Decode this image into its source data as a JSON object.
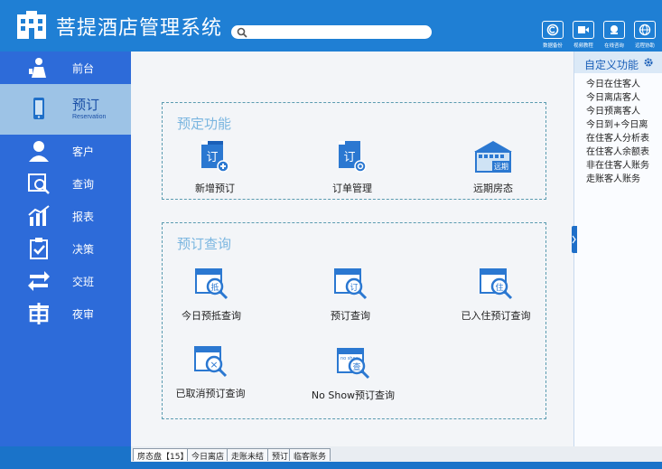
{
  "header": {
    "title": "菩提酒店管理系统",
    "search_placeholder": "",
    "tools": [
      {
        "label": "数据备份",
        "icon": "backup-icon"
      },
      {
        "label": "视频教程",
        "icon": "video-icon"
      },
      {
        "label": "在线咨询",
        "icon": "chat-icon"
      },
      {
        "label": "远程协助",
        "icon": "remote-icon"
      }
    ]
  },
  "sidebar": {
    "items": [
      {
        "label": "前台"
      },
      {
        "label": "预订",
        "sub": "Reservation"
      },
      {
        "label": "客户"
      },
      {
        "label": "查询"
      },
      {
        "label": "报表"
      },
      {
        "label": "决策"
      },
      {
        "label": "交班"
      },
      {
        "label": "夜审"
      }
    ]
  },
  "booking_panel": {
    "title": "预定功能",
    "items": [
      {
        "label": "新增预订",
        "glyph": "订"
      },
      {
        "label": "订单管理",
        "glyph": "订"
      },
      {
        "label": "远期房态",
        "glyph": "远期"
      }
    ]
  },
  "query_panel": {
    "title": "预订查询",
    "items": [
      {
        "label": "今日预抵查询",
        "glyph": "抵"
      },
      {
        "label": "预订查询",
        "glyph": "订"
      },
      {
        "label": "已入住预订查询",
        "glyph": "住"
      },
      {
        "label": "已取消预订查询",
        "glyph": "×"
      },
      {
        "label": "No Show预订查询",
        "glyph": "查",
        "mini": "no show"
      }
    ]
  },
  "right_panel": {
    "title": "自定义功能",
    "items": [
      "今日在住客人",
      "今日离店客人",
      "今日预离客人",
      "今日到+今日离",
      "在住客人分析表",
      "在住客人余额表",
      "非在住客人账务",
      "走账客人账务"
    ]
  },
  "bottom_tabs": [
    "房态盘【15】",
    "今日离店",
    "走账未结",
    "预订",
    "临客账务"
  ],
  "colors": {
    "header": "#1f7fd4",
    "sidebar": "#2d6bd9",
    "active": "#9dc3e6",
    "accent": "#1a5fb8"
  }
}
